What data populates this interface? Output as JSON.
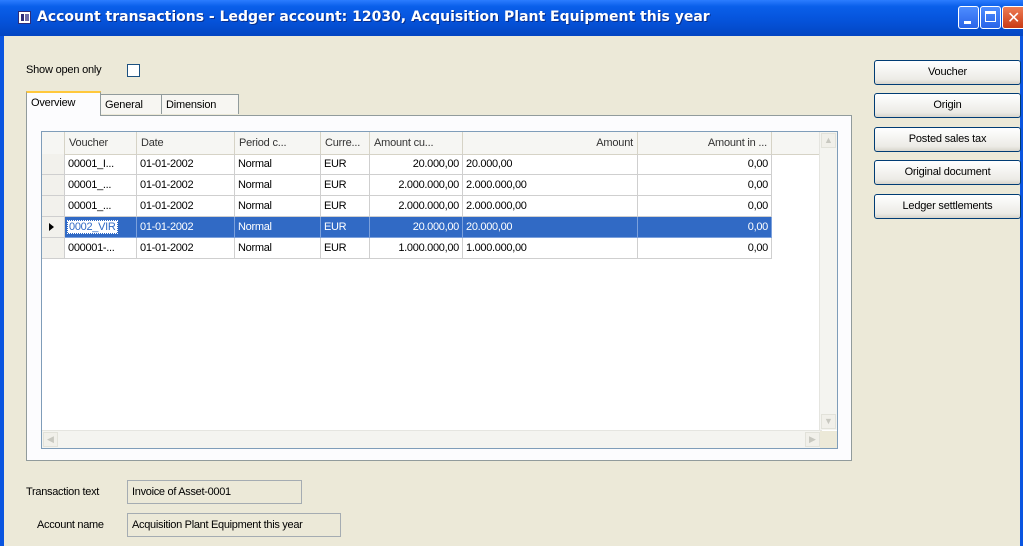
{
  "window": {
    "title": "Account transactions - Ledger account: 12030, Acquisition Plant Equipment this year",
    "close_glyph": "✕"
  },
  "filter": {
    "show_open_only_label": "Show open only",
    "show_open_only_checked": false
  },
  "tabs": [
    {
      "label": "Overview",
      "active": true
    },
    {
      "label": "General",
      "active": false
    },
    {
      "label": "Dimension",
      "active": false
    }
  ],
  "grid": {
    "columns": [
      "Voucher",
      "Date",
      "Period c...",
      "Curre...",
      "Amount cu...",
      "Amount",
      "Amount in ..."
    ],
    "rows": [
      {
        "voucher": "00001_I...",
        "date": "01-01-2002",
        "period": "Normal",
        "currency": "EUR",
        "amount_cur": "20.000,00",
        "amount": "20.000,00",
        "amount_in": "0,00",
        "selected": false
      },
      {
        "voucher": "00001_...",
        "date": "01-01-2002",
        "period": "Normal",
        "currency": "EUR",
        "amount_cur": "2.000.000,00",
        "amount": "2.000.000,00",
        "amount_in": "0,00",
        "selected": false
      },
      {
        "voucher": "00001_...",
        "date": "01-01-2002",
        "period": "Normal",
        "currency": "EUR",
        "amount_cur": "2.000.000,00",
        "amount": "2.000.000,00",
        "amount_in": "0,00",
        "selected": false
      },
      {
        "voucher": "0002_VIR",
        "date": "01-01-2002",
        "period": "Normal",
        "currency": "EUR",
        "amount_cur": "20.000,00",
        "amount": "20.000,00",
        "amount_in": "0,00",
        "selected": true
      },
      {
        "voucher": "000001-...",
        "date": "01-01-2002",
        "period": "Normal",
        "currency": "EUR",
        "amount_cur": "1.000.000,00",
        "amount": "1.000.000,00",
        "amount_in": "0,00",
        "selected": false
      }
    ]
  },
  "buttons": {
    "voucher": "Voucher",
    "origin": "Origin",
    "posted_sales_tax": "Posted sales tax",
    "original_document": "Original document",
    "ledger_settlements": "Ledger settlements"
  },
  "details": {
    "transaction_text_label": "Transaction text",
    "transaction_text_value": "Invoice of Asset-0001",
    "account_name_label": "Account name",
    "account_name_value": "Acquisition Plant Equipment this year"
  },
  "colors": {
    "titlebar": "#0552d9",
    "selection": "#316ac5",
    "close_button": "#c93a14"
  }
}
